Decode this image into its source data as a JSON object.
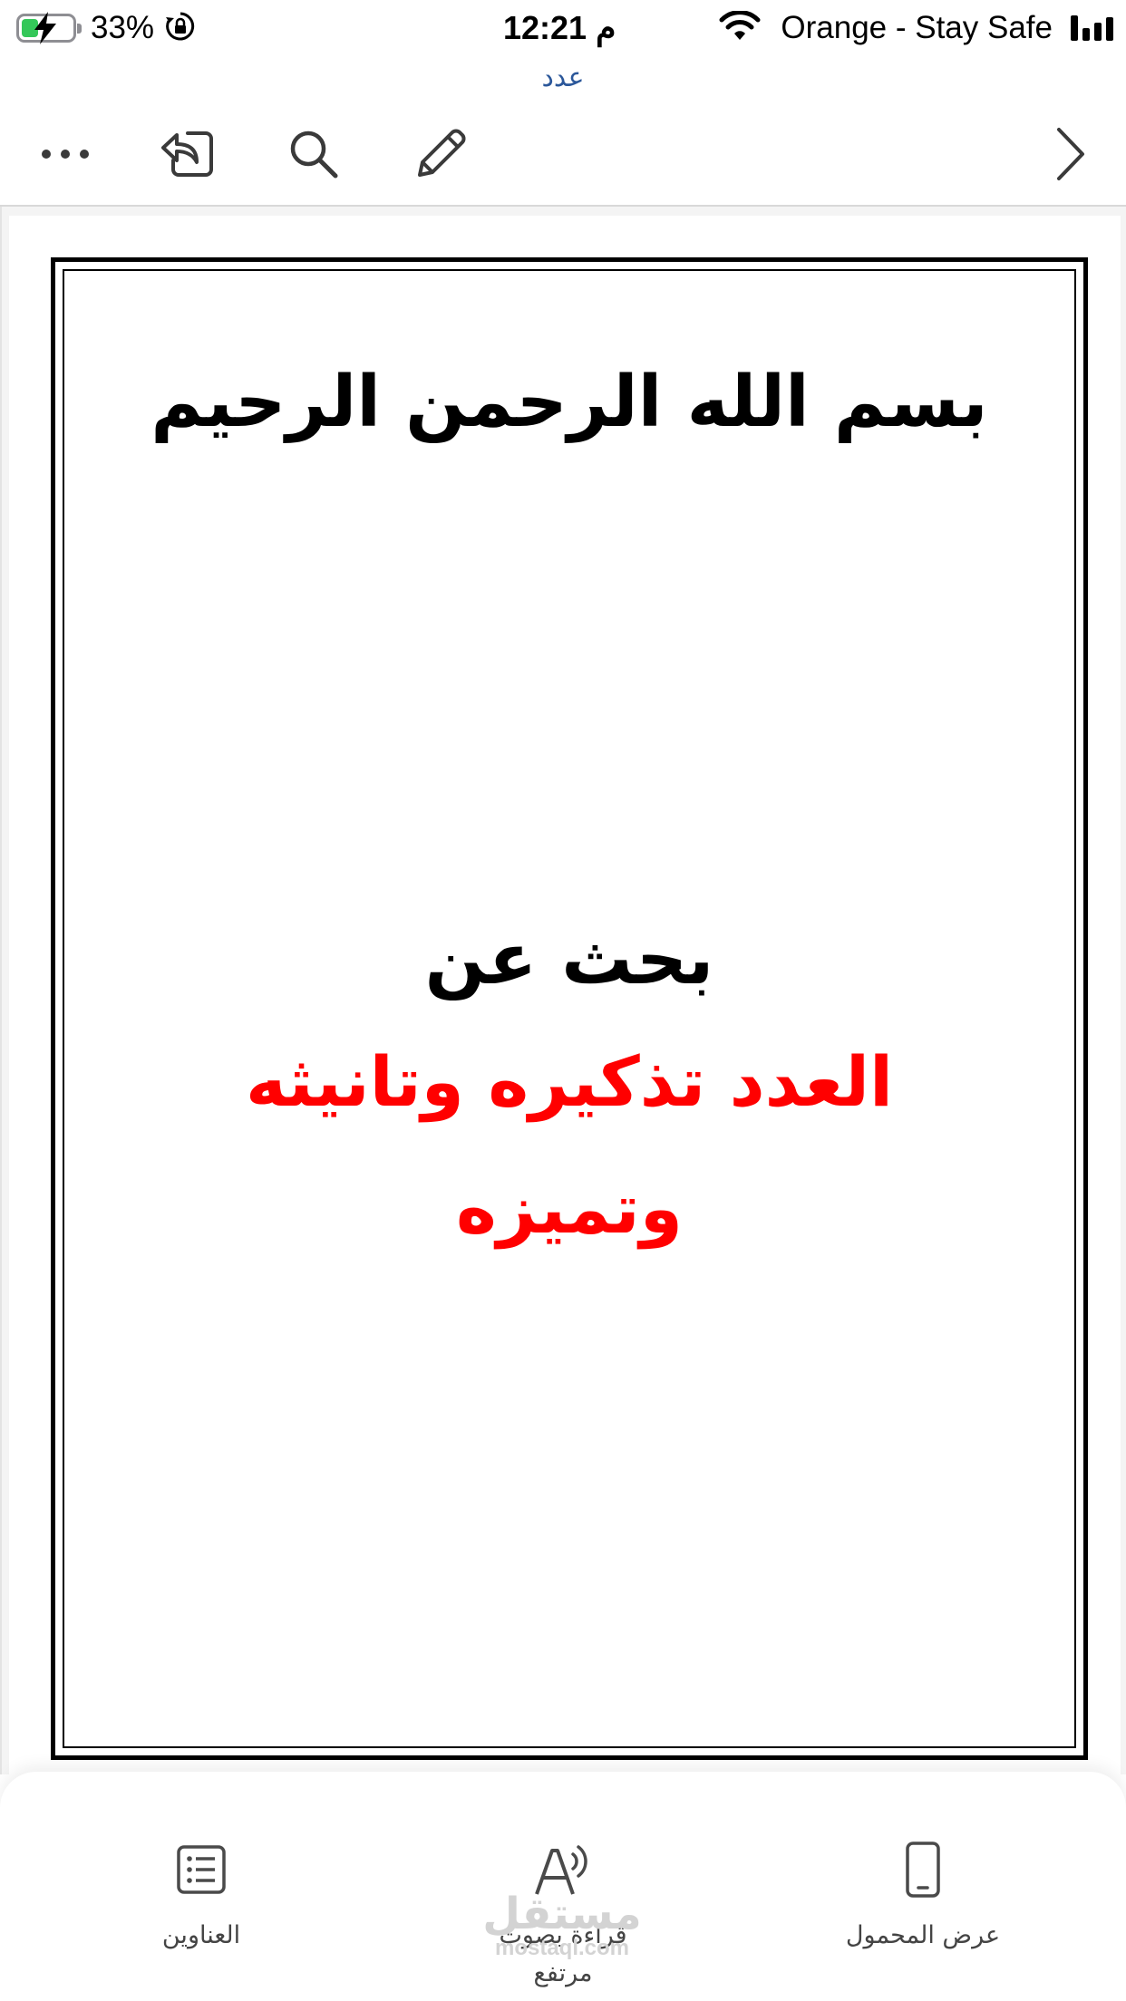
{
  "status_bar": {
    "battery_percent": "33%",
    "battery_level": 0.33,
    "time": "12:21 م",
    "carrier": "Orange - Stay Safe"
  },
  "document_title": "عدد",
  "toolbar": {
    "icons": [
      "more-icon",
      "share-icon",
      "search-icon",
      "pencil-icon",
      "chevron-right-icon"
    ]
  },
  "page": {
    "basmala": "بسم الله الرحمن الرحيم",
    "intro": "بحث عن",
    "title_line1": "العدد تذكيره وتانيثه",
    "title_line2": "وتميزه",
    "title_color": "#ff0000"
  },
  "bottom_panel": {
    "headings_label": "العناوين",
    "read_aloud_label_line1": "قراءة بصوت",
    "read_aloud_label_line2": "مرتفع",
    "mobile_view_label": "عرض المحمول"
  },
  "watermark": {
    "arabic": "مستقل",
    "latin": "mostaql.com"
  },
  "colors": {
    "accent": "#2b579a",
    "battery_fill": "#34c759",
    "title_red": "#ff0000"
  }
}
